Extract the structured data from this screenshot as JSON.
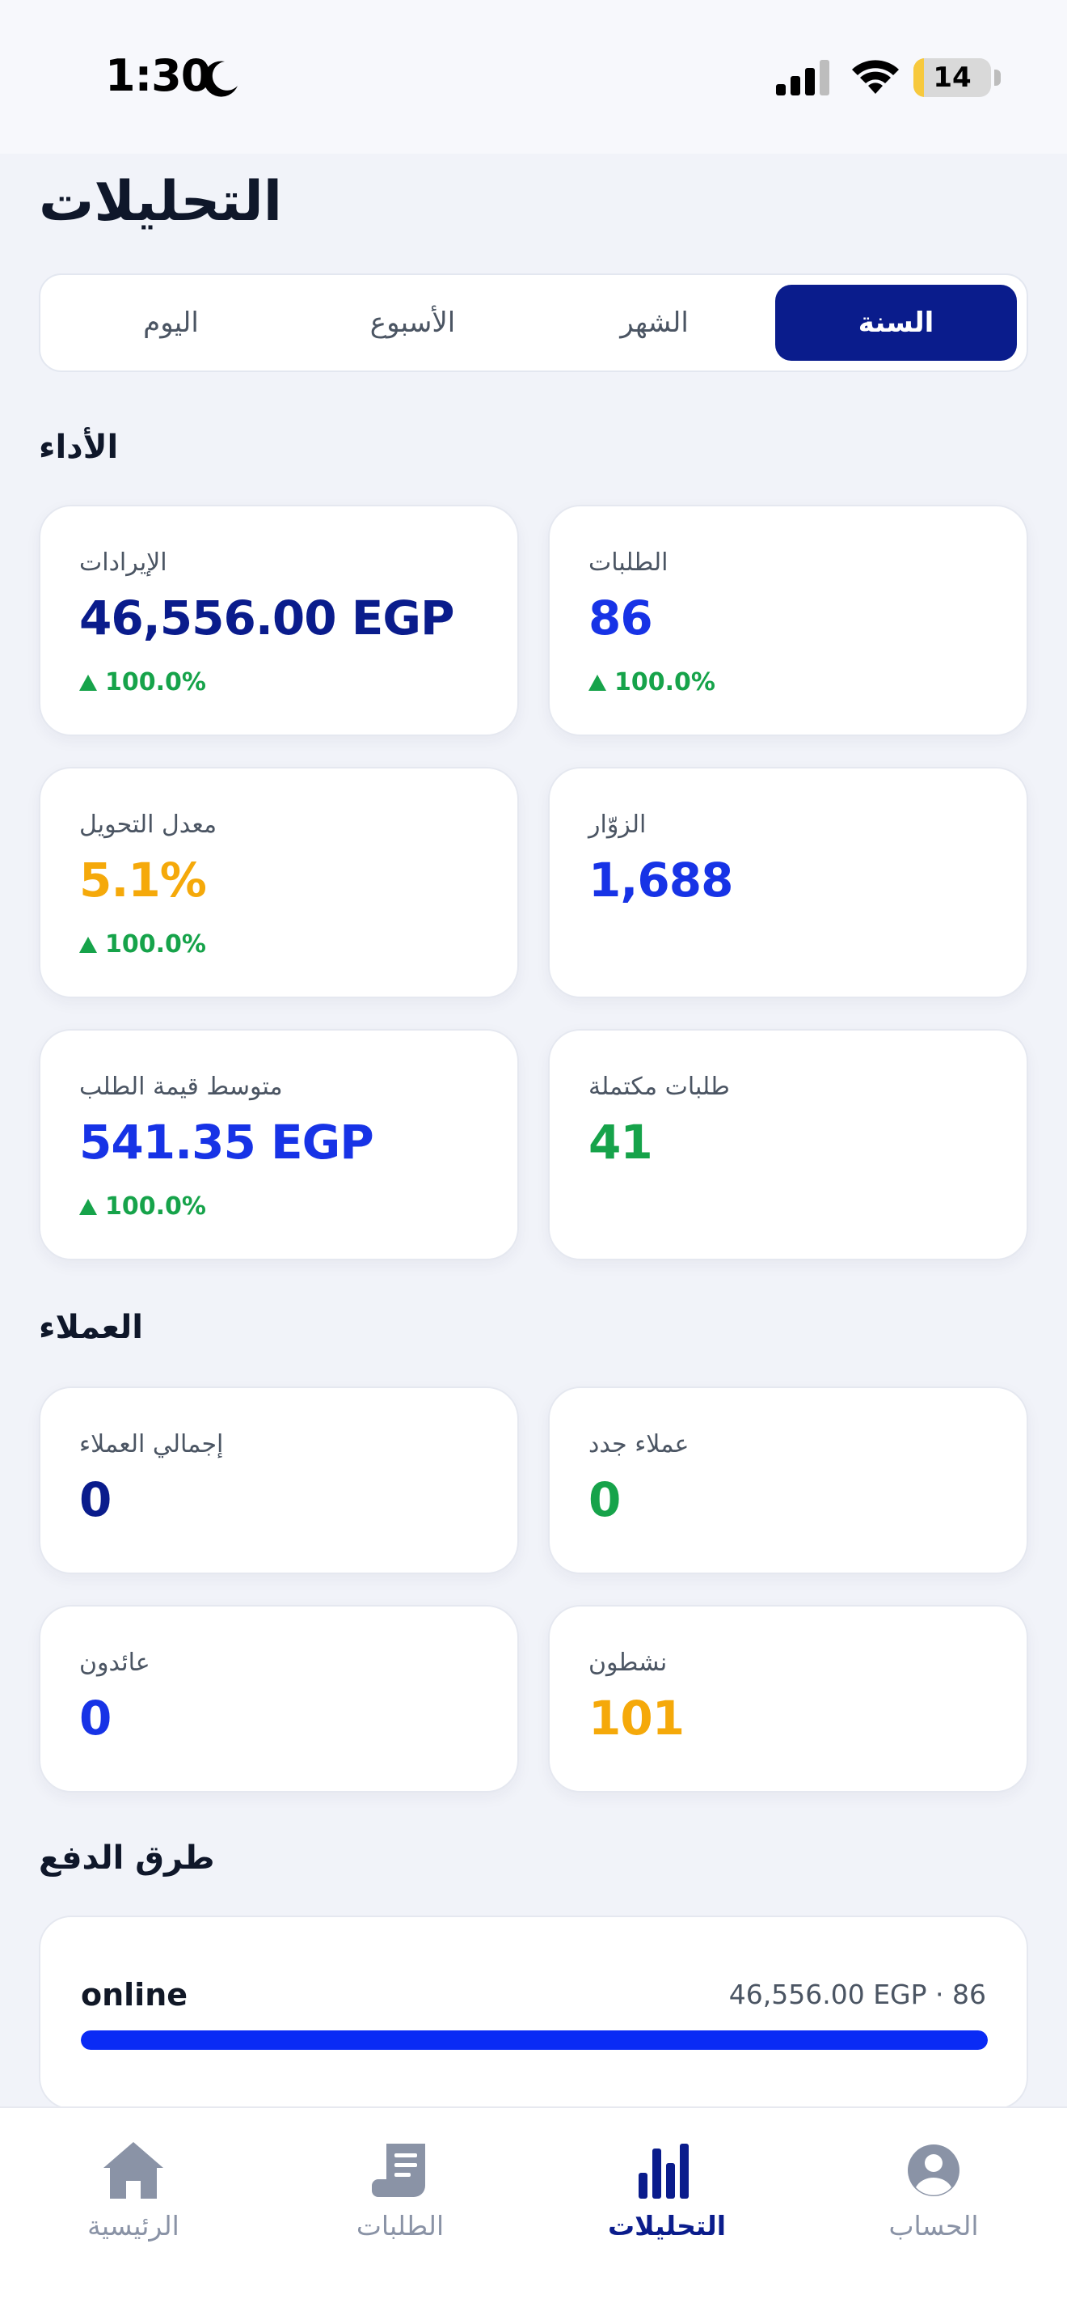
{
  "status_bar": {
    "time": "1:30",
    "battery": "14",
    "battery_level": 0.14
  },
  "page_title": "التحليلات",
  "segments": [
    {
      "label": "السنة",
      "active": true
    },
    {
      "label": "الشهر",
      "active": false
    },
    {
      "label": "الأسبوع",
      "active": false
    },
    {
      "label": "اليوم",
      "active": false
    }
  ],
  "performance": {
    "title": "الأداء",
    "orders": {
      "label": "الطلبات",
      "value": "86",
      "change": "100.0%"
    },
    "revenue": {
      "label": "الإيرادات",
      "value": "46,556.00 EGP",
      "change": "100.0%"
    },
    "visitors": {
      "label": "الزوّار",
      "value": "1,688"
    },
    "conversion": {
      "label": "معدل التحويل",
      "value": "5.1%",
      "change": "100.0%"
    },
    "completed": {
      "label": "طلبات مكتملة",
      "value": "41"
    },
    "avg_order": {
      "label": "متوسط قيمة الطلب",
      "value": "541.35 EGP",
      "change": "100.0%"
    }
  },
  "customers": {
    "title": "العملاء",
    "new": {
      "label": "عملاء جدد",
      "value": "0"
    },
    "total": {
      "label": "إجمالي العملاء",
      "value": "0"
    },
    "active": {
      "label": "نشطون",
      "value": "101"
    },
    "returning": {
      "label": "عائدون",
      "value": "0"
    }
  },
  "payments": {
    "title": "طرق الدفع",
    "method": "online",
    "meta": "46,556.00 EGP · 86",
    "share": 1.0
  },
  "tabbar": [
    {
      "label": "الحساب",
      "icon": "account-icon",
      "active": false
    },
    {
      "label": "التحليلات",
      "icon": "analytics-icon",
      "active": true
    },
    {
      "label": "الطلبات",
      "icon": "orders-icon",
      "active": false
    },
    {
      "label": "الرئيسية",
      "icon": "home-icon",
      "active": false
    }
  ],
  "colors": {
    "navy": "#0A1C8C",
    "blue": "#1733E6",
    "amber": "#F5A90A",
    "green": "#16A34A",
    "muted": "#8A93A6"
  }
}
